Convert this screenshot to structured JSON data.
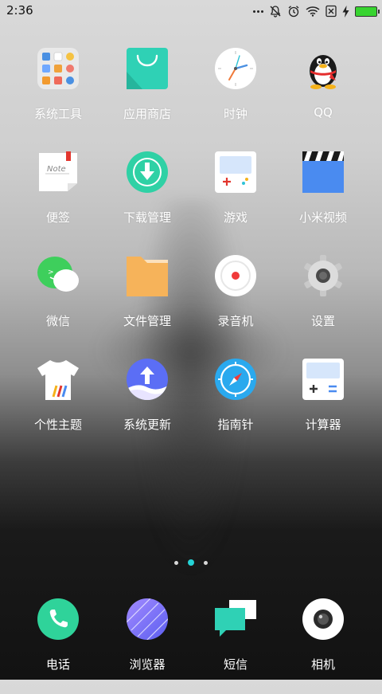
{
  "status_bar": {
    "time": "2:36"
  },
  "apps": [
    {
      "label": "系统工具",
      "icon": "folder-icon"
    },
    {
      "label": "应用商店",
      "icon": "app-store-icon"
    },
    {
      "label": "时钟",
      "icon": "clock-icon"
    },
    {
      "label": "QQ",
      "icon": "qq-penguin-icon"
    },
    {
      "label": "便签",
      "icon": "notes-icon"
    },
    {
      "label": "下载管理",
      "icon": "download-icon"
    },
    {
      "label": "游戏",
      "icon": "game-icon"
    },
    {
      "label": "小米视频",
      "icon": "video-clapper-icon"
    },
    {
      "label": "微信",
      "icon": "wechat-icon"
    },
    {
      "label": "文件管理",
      "icon": "folder-file-icon"
    },
    {
      "label": "录音机",
      "icon": "recorder-icon"
    },
    {
      "label": "设置",
      "icon": "gear-icon"
    },
    {
      "label": "个性主题",
      "icon": "tshirt-icon"
    },
    {
      "label": "系统更新",
      "icon": "update-arrow-icon"
    },
    {
      "label": "指南针",
      "icon": "compass-icon"
    },
    {
      "label": "计算器",
      "icon": "calculator-icon"
    }
  ],
  "dock": [
    {
      "label": "电话",
      "icon": "phone-icon"
    },
    {
      "label": "浏览器",
      "icon": "browser-icon"
    },
    {
      "label": "短信",
      "icon": "message-icon"
    },
    {
      "label": "相机",
      "icon": "camera-icon"
    }
  ],
  "page_indicator": {
    "pages": 3,
    "current": 2
  },
  "colors": {
    "accent": "#25d3d6",
    "battery": "#38d430"
  }
}
